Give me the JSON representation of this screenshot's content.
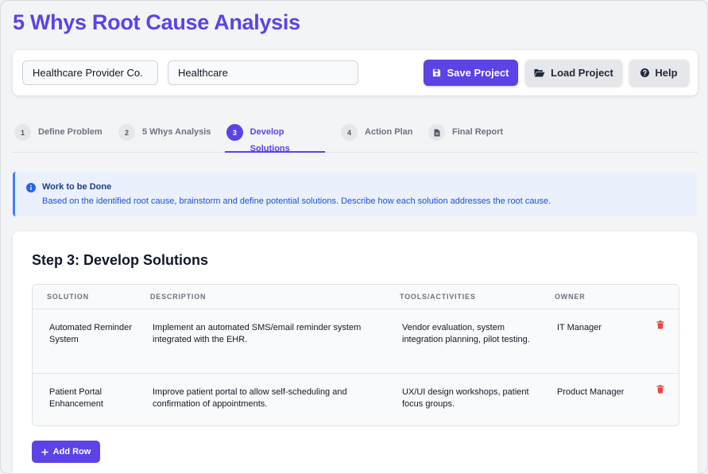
{
  "app": {
    "title": "5 Whys Root Cause Analysis"
  },
  "project": {
    "company_value": "Healthcare Provider Co.",
    "industry_value": "Healthcare",
    "save_label": "Save Project",
    "load_label": "Load Project",
    "help_label": "Help"
  },
  "steps": [
    {
      "num": "1",
      "label": "Define Problem"
    },
    {
      "num": "2",
      "label": "5 Whys Analysis"
    },
    {
      "num": "3",
      "label": "Develop Solutions"
    },
    {
      "num": "4",
      "label": "Action Plan"
    },
    {
      "num": "",
      "label": "Final Report"
    }
  ],
  "info": {
    "title": "Work to be Done",
    "text": "Based on the identified root cause, brainstorm and define potential solutions. Describe how each solution addresses the root cause."
  },
  "main": {
    "title": "Step 3: Develop Solutions",
    "columns": [
      "SOLUTION",
      "DESCRIPTION",
      "TOOLS/ACTIVITIES",
      "OWNER"
    ],
    "rows": [
      {
        "solution": "Automated Reminder System",
        "description": "Implement an automated SMS/email reminder system integrated with the EHR.",
        "tools": "Vendor evaluation, system integration planning, pilot testing.",
        "owner": "IT Manager"
      },
      {
        "solution": "Patient Portal Enhancement",
        "description": "Improve patient portal to allow self-scheduling and confirmation of appointments.",
        "tools": "UX/UI design workshops, patient focus groups.",
        "owner": "Product Manager"
      }
    ],
    "add_row_label": "Add Row"
  },
  "icons": {
    "save": "save-icon",
    "load": "folder-open-icon",
    "help": "question-circle-icon",
    "info": "info-circle-icon",
    "report": "document-icon",
    "delete": "trash-icon",
    "add": "plus-icon"
  },
  "colors": {
    "accent": "#5b43e6",
    "info_border": "#3b82f6",
    "info_bg": "#eaf1fd",
    "delete": "#ef4444"
  }
}
